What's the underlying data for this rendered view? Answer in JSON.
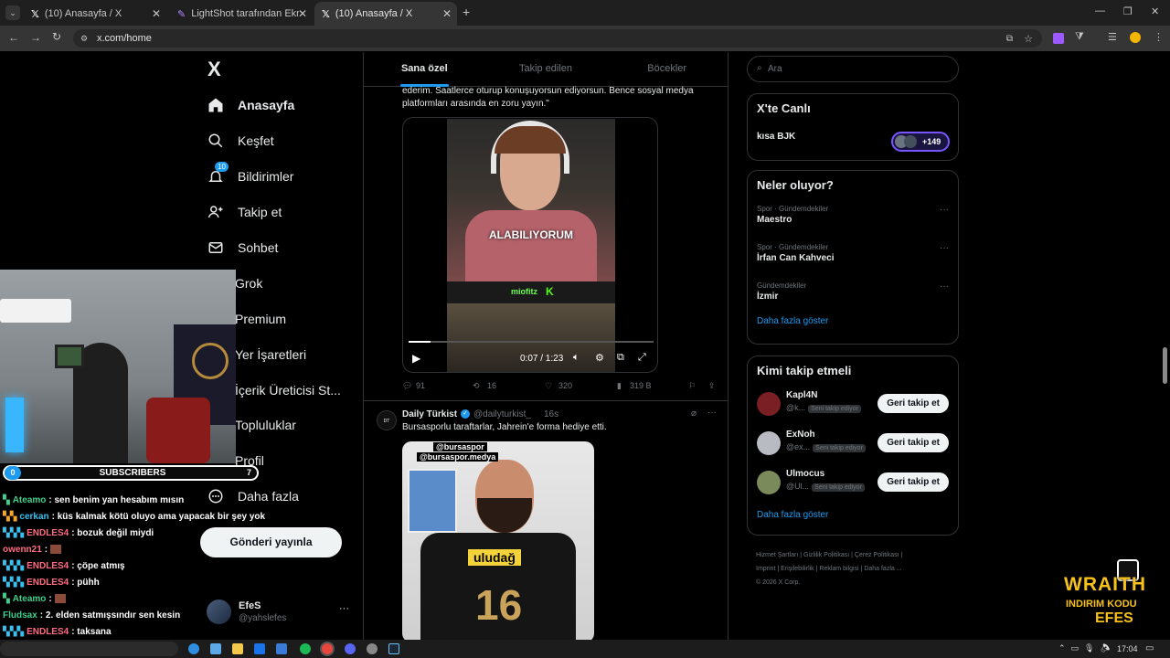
{
  "browser": {
    "tabs": [
      {
        "label": "(10) Anasayfa / X",
        "active": false
      },
      {
        "label": "LightShot tarafından Ekran Gör",
        "active": false
      },
      {
        "label": "(10) Anasayfa / X",
        "active": true
      }
    ],
    "new_tab": "+",
    "url": "x.com/home"
  },
  "left_nav": {
    "logo": "X",
    "items": [
      {
        "label": "Anasayfa",
        "icon": "home-icon",
        "bold": true
      },
      {
        "label": "Keşfet",
        "icon": "search-icon"
      },
      {
        "label": "Bildirimler",
        "icon": "bell-icon",
        "badge": "10"
      },
      {
        "label": "Takip et",
        "icon": "add-user-icon"
      },
      {
        "label": "Sohbet",
        "icon": "mail-icon"
      },
      {
        "label": "Grok",
        "icon": "grok-icon"
      },
      {
        "label": "Premium",
        "icon": "x-icon"
      },
      {
        "label": "Yer İşaretleri",
        "icon": "bookmark-icon"
      },
      {
        "label": "İçerik Üreticisi St...",
        "icon": "studio-icon"
      },
      {
        "label": "Topluluklar",
        "icon": "community-icon"
      },
      {
        "label": "Profil",
        "icon": "profile-icon"
      },
      {
        "label": "Daha fazla",
        "icon": "more-icon"
      }
    ],
    "post_button": "Gönderi yayınla",
    "account": {
      "name": "EfeS",
      "handle": "@yahslefes",
      "more": "···"
    }
  },
  "feed": {
    "tabs": [
      "Sana özel",
      "Takip edilen",
      "Böcekler"
    ],
    "post1": {
      "text": "ederim. Saatlerce oturup konuşuyorsun ediyorsun. Bence sosyal medya platformları arasında en zoru yayın.\"",
      "video_caption": "ALABILIYORUM",
      "video_brand": "miofitz",
      "video_time": "0:07 / 1:23",
      "progress": 0.09,
      "stats": {
        "replies": "91",
        "reposts": "16",
        "likes": "320",
        "views": "319 B"
      }
    },
    "post2": {
      "author": "Daily Türkist",
      "handle": "@dailyturkist_",
      "time": "16s",
      "text": "Bursasporlu taraftarlar, Jahrein'e forma hediye etti.",
      "tags": [
        "@bursaspor",
        "@bursaspor.medya"
      ],
      "shirt_brand": "uludağ",
      "shirt_number": "16"
    }
  },
  "right": {
    "search_placeholder": "Ara",
    "live": {
      "title": "X'te Canlı",
      "item": "kısa BJK",
      "count": "+149"
    },
    "trends": {
      "title": "Neler oluyor?",
      "items": [
        {
          "category": "Spor · Gündemdekiler",
          "name": "Maestro"
        },
        {
          "category": "Spor · Gündemdekiler",
          "name": "İrfan Can Kahveci"
        },
        {
          "category": "Gündemdekiler",
          "name": "İzmir"
        }
      ],
      "more": "Daha fazla göster"
    },
    "who_to_follow": {
      "title": "Kimi takip etmeli",
      "items": [
        {
          "name": "Kapl4N",
          "handle": "@k...",
          "badge": "Seni takip ediyor",
          "button": "Geri takip et"
        },
        {
          "name": "ExNoh",
          "handle": "@ex...",
          "badge": "Seni takip ediyor",
          "button": "Geri takip et"
        },
        {
          "name": "Ulmocus",
          "handle": "@Ul...",
          "badge": "Seni takip ediyor",
          "button": "Geri takip et"
        }
      ],
      "more": "Daha fazla göster"
    },
    "footer": {
      "line1": [
        "Hizmet Şartları",
        "Gizlilik Politikası",
        "Çerez Politikası"
      ],
      "line2": [
        "Imprint",
        "Erişilebilirlik",
        "Reklam bilgisi",
        "Daha fazla ..."
      ],
      "copyright": "© 2026 X Corp."
    }
  },
  "stream_overlay": {
    "subscribers_label": "SUBSCRIBERS",
    "sub_left": "0",
    "sub_right": "7",
    "chat": [
      {
        "user": "Ateamo",
        "msg": ": sen benim yan hesabım mısın",
        "color": "#3ecf8e"
      },
      {
        "user": "cerkan",
        "msg": ": küs kalmak kötü oluyo ama yapacak bir şey yok",
        "color": "#39c0f0"
      },
      {
        "user": "ENDLES4",
        "msg": ": bozuk değil miydi",
        "color": "#ff6b81"
      },
      {
        "user": "owenn21",
        "msg": ":",
        "color": "#ff6b81"
      },
      {
        "user": "ENDLES4",
        "msg": ": çöpe atmış",
        "color": "#ff6b81"
      },
      {
        "user": "ENDLES4",
        "msg": ": pühh",
        "color": "#ff6b81"
      },
      {
        "user": "Ateamo",
        "msg": ":",
        "color": "#3ecf8e"
      },
      {
        "user": "Fludsax",
        "msg": ": 2. elden satmışsındır sen kesin",
        "color": "#3ecf8e"
      },
      {
        "user": "ENDLES4",
        "msg": ": taksana",
        "color": "#ff6b81"
      }
    ],
    "promo": {
      "line1": "WRAITH",
      "line2": "INDIRIM KODU",
      "line3": "EFES"
    }
  },
  "taskbar": {
    "time": "17:04"
  },
  "colors": {
    "accent": "#1d9bf0",
    "bg": "#000000",
    "border": "#2f3336",
    "muted": "#71767b"
  }
}
